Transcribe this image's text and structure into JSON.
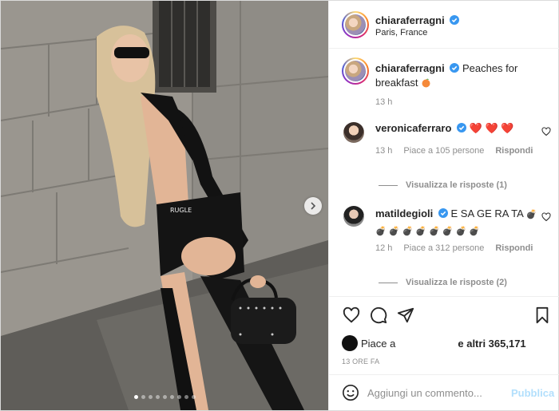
{
  "post": {
    "username": "chiaraferragni",
    "location": "Paris, France",
    "image_label": "RUGLE",
    "carousel": {
      "total": 9,
      "active": 1
    }
  },
  "caption": {
    "username": "chiaraferragni",
    "text": "Peaches for breakfast",
    "emoji": "peach-emoji",
    "time": "13 h"
  },
  "comments": [
    {
      "username": "veronicaferraro",
      "text": "❤️ ❤️ ❤️",
      "time": "13 h",
      "likes": "Piace a 105 persone",
      "reply": "Rispondi",
      "view_replies": "Visualizza le risposte (1)"
    },
    {
      "username": "matildegioli",
      "text": "E SA GE RA TA",
      "emoji_row": "💣 💣 💣 💣 💣 💣 💣 💣 💣",
      "time": "12 h",
      "likes": "Piace a 312 persone",
      "reply": "Rispondi",
      "view_replies": "Visualizza le risposte (2)"
    }
  ],
  "actions": {
    "icons": [
      "heart-icon",
      "comment-icon",
      "share-icon",
      "save-icon"
    ],
    "likes_prefix": "Piace a",
    "likes_suffix": "e altri 365,171",
    "time_ago": "13 ORE FA"
  },
  "add_comment": {
    "placeholder": "Aggiungi un commento...",
    "publish_label": "Pubblica"
  },
  "colors": {
    "verified": "#3897f0",
    "heart_red": "#ed4956",
    "publish_disabled": "#b2dffc",
    "muted": "#8e8e8e"
  }
}
